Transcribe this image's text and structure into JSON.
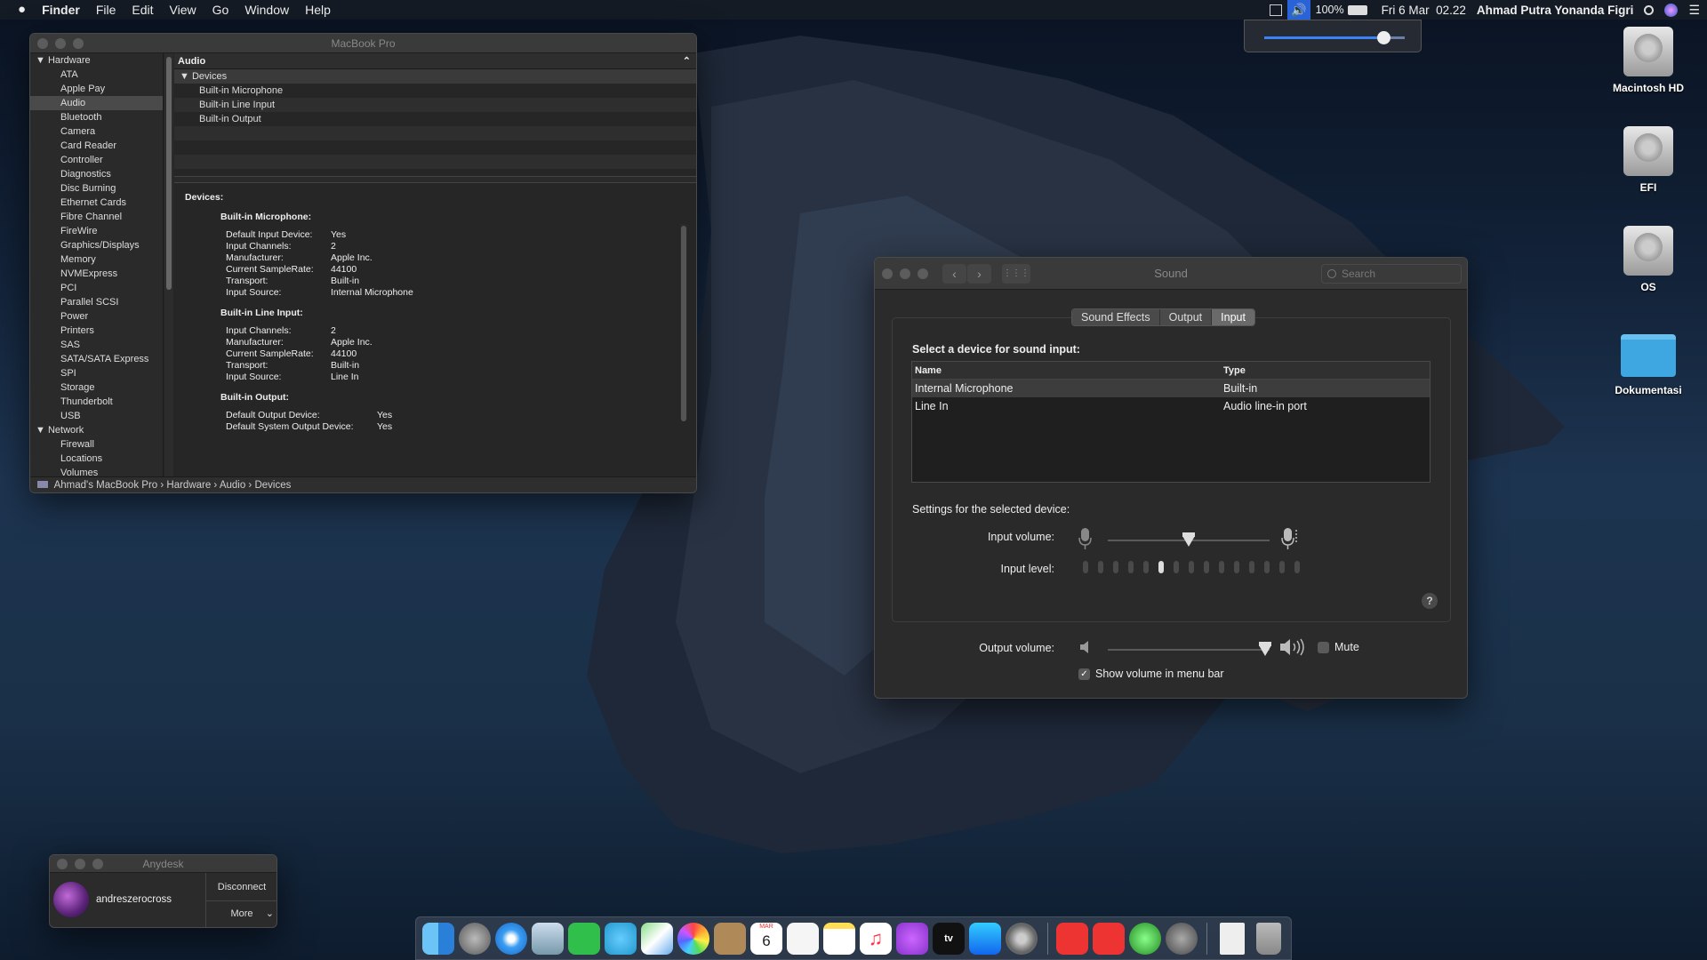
{
  "menubar": {
    "apple": "",
    "app": "Finder",
    "items": [
      "File",
      "Edit",
      "View",
      "Go",
      "Window",
      "Help"
    ],
    "battery": "100%",
    "datetime": "Fri 6 Mar  02.22",
    "user": "Ahmad Putra Yonanda Figri"
  },
  "volume_popup": {
    "level": 0.85
  },
  "desktop_icons": [
    "Macintosh HD",
    "EFI",
    "OS",
    "Dokumentasi"
  ],
  "sysinfo": {
    "title": "MacBook Pro",
    "sidebar": [
      {
        "label": "Hardware",
        "group": true
      },
      {
        "label": "ATA"
      },
      {
        "label": "Apple Pay"
      },
      {
        "label": "Audio",
        "selected": true
      },
      {
        "label": "Bluetooth"
      },
      {
        "label": "Camera"
      },
      {
        "label": "Card Reader"
      },
      {
        "label": "Controller"
      },
      {
        "label": "Diagnostics"
      },
      {
        "label": "Disc Burning"
      },
      {
        "label": "Ethernet Cards"
      },
      {
        "label": "Fibre Channel"
      },
      {
        "label": "FireWire"
      },
      {
        "label": "Graphics/Displays"
      },
      {
        "label": "Memory"
      },
      {
        "label": "NVMExpress"
      },
      {
        "label": "PCI"
      },
      {
        "label": "Parallel SCSI"
      },
      {
        "label": "Power"
      },
      {
        "label": "Printers"
      },
      {
        "label": "SAS"
      },
      {
        "label": "SATA/SATA Express"
      },
      {
        "label": "SPI"
      },
      {
        "label": "Storage"
      },
      {
        "label": "Thunderbolt"
      },
      {
        "label": "USB"
      },
      {
        "label": "Network",
        "group": true
      },
      {
        "label": "Firewall"
      },
      {
        "label": "Locations"
      },
      {
        "label": "Volumes"
      }
    ],
    "column_header": "Audio",
    "tree_group": "Devices",
    "tree_items": [
      "Built-in Microphone",
      "Built-in Line Input",
      "Built-in Output"
    ],
    "detail": {
      "heading": "Devices:",
      "sections": [
        {
          "title": "Built-in Microphone:",
          "rows": [
            [
              "Default Input Device:",
              "Yes"
            ],
            [
              "Input Channels:",
              "2"
            ],
            [
              "Manufacturer:",
              "Apple Inc."
            ],
            [
              "Current SampleRate:",
              "44100"
            ],
            [
              "Transport:",
              "Built-in"
            ],
            [
              "Input Source:",
              "Internal Microphone"
            ]
          ]
        },
        {
          "title": "Built-in Line Input:",
          "rows": [
            [
              "Input Channels:",
              "2"
            ],
            [
              "Manufacturer:",
              "Apple Inc."
            ],
            [
              "Current SampleRate:",
              "44100"
            ],
            [
              "Transport:",
              "Built-in"
            ],
            [
              "Input Source:",
              "Line In"
            ]
          ]
        },
        {
          "title": "Built-in Output:",
          "wide": true,
          "rows": [
            [
              "Default Output Device:",
              "Yes"
            ],
            [
              "Default System Output Device:",
              "Yes"
            ]
          ]
        }
      ]
    },
    "pathbar": "Ahmad's MacBook Pro › Hardware › Audio › Devices"
  },
  "sound": {
    "title": "Sound",
    "search_placeholder": "Search",
    "tabs": [
      {
        "label": "Sound Effects"
      },
      {
        "label": "Output"
      },
      {
        "label": "Input",
        "active": true
      }
    ],
    "select_label": "Select a device for sound input:",
    "table_headers": [
      "Name",
      "Type"
    ],
    "devices": [
      {
        "name": "Internal Microphone",
        "type": "Built-in",
        "selected": true
      },
      {
        "name": "Line In",
        "type": "Audio line-in port"
      }
    ],
    "settings_label": "Settings for the selected device:",
    "input_volume_label": "Input volume:",
    "input_volume": 0.5,
    "input_level_label": "Input level:",
    "input_level_segments": 15,
    "input_level_active": 6,
    "help": "?",
    "output_volume_label": "Output volume:",
    "output_volume": 0.97,
    "mute_label": "Mute",
    "show_volume_label": "Show volume in menu bar",
    "show_volume_checked": true
  },
  "anydesk": {
    "title": "Anydesk",
    "user": "andreszerocross",
    "disconnect": "Disconnect",
    "more": "More"
  },
  "dock": {
    "calendar_month": "MAR",
    "calendar_day": "6",
    "tv_label": "tv"
  }
}
